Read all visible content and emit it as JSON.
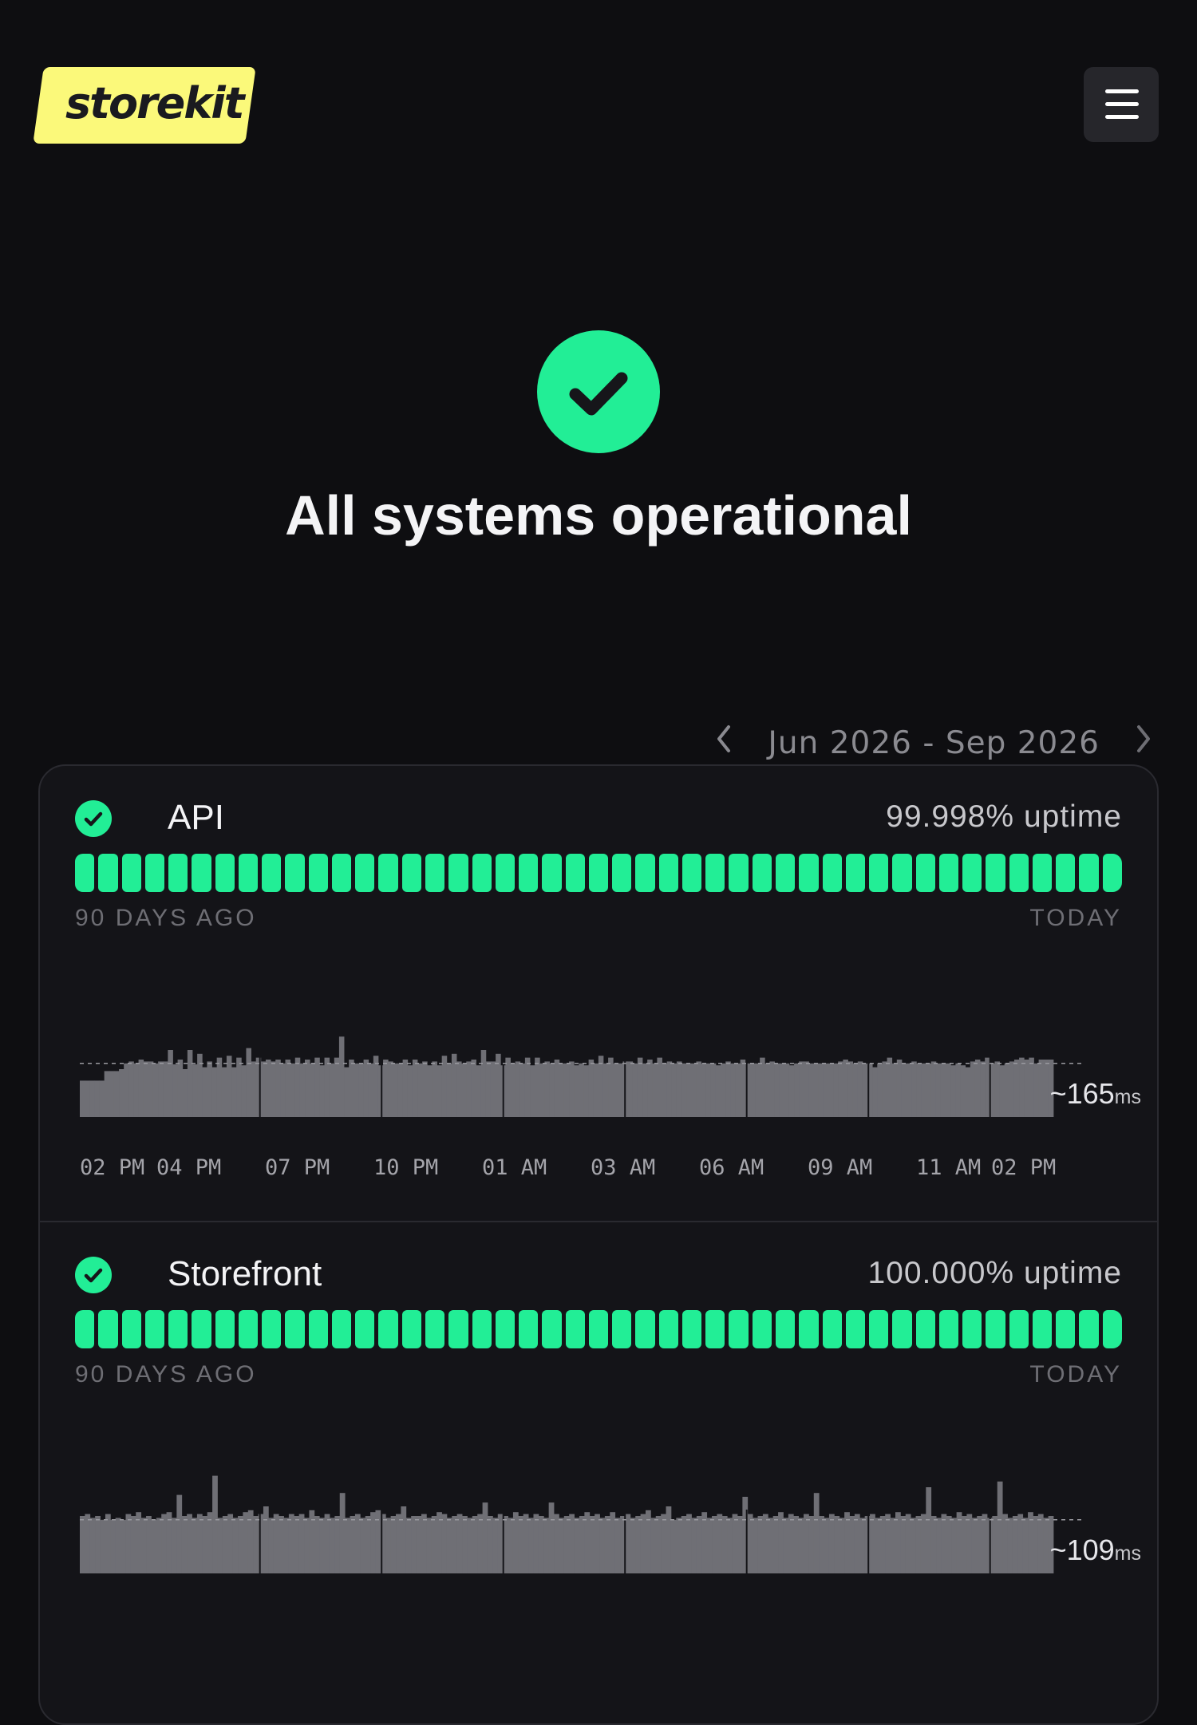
{
  "header": {
    "logo_text": "storekit",
    "menu_icon": "hamburger-menu-icon"
  },
  "hero": {
    "icon": "check-circle-icon",
    "title": "All systems operational"
  },
  "date_range": {
    "label": "Jun 2026 - Sep 2026",
    "prev_icon": "chevron-left-icon",
    "next_icon": "chevron-right-icon"
  },
  "colors": {
    "accent": "#22ee96",
    "logo_bg": "#fbf97a",
    "background": "#0e0e11",
    "card": "#141418"
  },
  "services": [
    {
      "name": "API",
      "uptime": "99.998% uptime",
      "status": "operational",
      "left_label": "90 DAYS AGO",
      "right_label": "TODAY",
      "latency_value": "~165",
      "latency_unit": "ms",
      "ticks": [
        "02 PM",
        "04 PM",
        "07 PM",
        "10 PM",
        "01 AM",
        "03 AM",
        "06 AM",
        "09 AM",
        "11 AM",
        "02 PM"
      ],
      "latency_series": [
        38,
        38,
        38,
        38,
        38,
        48,
        48,
        48,
        50,
        56,
        58,
        56,
        60,
        58,
        58,
        56,
        58,
        58,
        70,
        55,
        60,
        50,
        70,
        55,
        66,
        52,
        58,
        52,
        62,
        52,
        64,
        52,
        62,
        54,
        72,
        58,
        62,
        58,
        60,
        58,
        60,
        56,
        60,
        56,
        62,
        56,
        60,
        56,
        62,
        54,
        62,
        56,
        62,
        84,
        52,
        60,
        56,
        56,
        60,
        56,
        64,
        54,
        60,
        58,
        56,
        56,
        60,
        54,
        60,
        56,
        58,
        54,
        58,
        54,
        64,
        56,
        66,
        58,
        56,
        58,
        60,
        54,
        70,
        58,
        58,
        66,
        54,
        62,
        56,
        58,
        56,
        62,
        54,
        62,
        56,
        58,
        56,
        60,
        56,
        56,
        58,
        54,
        56,
        54,
        60,
        56,
        64,
        56,
        62,
        56,
        56,
        58,
        58,
        56,
        62,
        56,
        60,
        56,
        62,
        56,
        58,
        56,
        58,
        56,
        56,
        56,
        58,
        56,
        56,
        56,
        54,
        56,
        58,
        56,
        56,
        60,
        56,
        56,
        56,
        62,
        56,
        58,
        56,
        56,
        56,
        54,
        56,
        58,
        58,
        56,
        56,
        56,
        56,
        56,
        56,
        58,
        60,
        58,
        56,
        58,
        56,
        56,
        52,
        56,
        58,
        62,
        56,
        60,
        56,
        56,
        58,
        56,
        56,
        56,
        58,
        56,
        56,
        56,
        54,
        56,
        54,
        52,
        58,
        60,
        58,
        62,
        56,
        58,
        54,
        56,
        58,
        60,
        62,
        60,
        62,
        56,
        60,
        60,
        60
      ]
    },
    {
      "name": "Storefront",
      "uptime": "100.000% uptime",
      "status": "operational",
      "left_label": "90 DAYS AGO",
      "right_label": "TODAY",
      "latency_value": "~109",
      "latency_unit": "ms",
      "latency_series": [
        60,
        62,
        58,
        60,
        56,
        62,
        56,
        58,
        56,
        62,
        60,
        64,
        58,
        60,
        56,
        58,
        62,
        64,
        58,
        82,
        60,
        62,
        58,
        62,
        60,
        64,
        102,
        58,
        60,
        62,
        58,
        60,
        64,
        66,
        60,
        62,
        70,
        58,
        62,
        60,
        58,
        62,
        60,
        62,
        58,
        66,
        60,
        58,
        62,
        58,
        60,
        84,
        58,
        60,
        62,
        58,
        60,
        64,
        66,
        62,
        58,
        60,
        62,
        70,
        58,
        60,
        60,
        62,
        58,
        60,
        64,
        62,
        58,
        60,
        62,
        60,
        58,
        60,
        62,
        74,
        60,
        58,
        62,
        60,
        58,
        64,
        60,
        62,
        58,
        62,
        60,
        58,
        74,
        62,
        58,
        60,
        62,
        58,
        60,
        64,
        60,
        62,
        58,
        60,
        64,
        58,
        60,
        62,
        58,
        60,
        62,
        66,
        58,
        60,
        62,
        70,
        56,
        58,
        60,
        62,
        58,
        60,
        64,
        58,
        60,
        62,
        60,
        58,
        62,
        60,
        80,
        62,
        58,
        60,
        62,
        58,
        60,
        64,
        58,
        62,
        60,
        58,
        62,
        60,
        84,
        60,
        58,
        62,
        60,
        58,
        64,
        60,
        62,
        58,
        60,
        62,
        58,
        60,
        62,
        58,
        64,
        60,
        62,
        58,
        60,
        62,
        90,
        60,
        58,
        62,
        60,
        58,
        64,
        60,
        62,
        58,
        60,
        62,
        58,
        60,
        96,
        62,
        58,
        60,
        62,
        58,
        64,
        60,
        62,
        58,
        60
      ]
    }
  ]
}
